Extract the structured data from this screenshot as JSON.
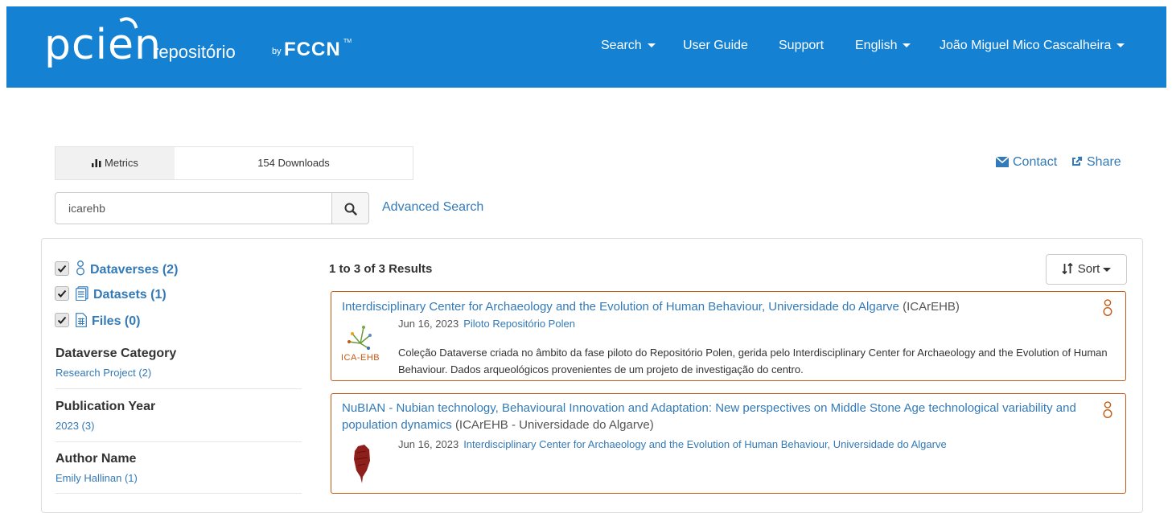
{
  "brand": {
    "logo_text": "pcien",
    "subtitle": "repositório",
    "by": "by",
    "fccn": "FCCN",
    "tm": "TM"
  },
  "nav": {
    "search": "Search",
    "user_guide": "User Guide",
    "support": "Support",
    "language": "English",
    "user": "João Miguel Mico Cascalheira"
  },
  "metrics": {
    "label": "Metrics",
    "downloads": "154 Downloads"
  },
  "actions": {
    "contact": "Contact",
    "share": "Share"
  },
  "search": {
    "value": "icarehb",
    "advanced": "Advanced Search"
  },
  "facets": {
    "types": [
      {
        "label": "Dataverses (2)",
        "checked": true,
        "icon": "dataverse-icon"
      },
      {
        "label": "Datasets (1)",
        "checked": true,
        "icon": "dataset-icon"
      },
      {
        "label": "Files (0)",
        "checked": true,
        "icon": "file-icon"
      }
    ],
    "groups": [
      {
        "title": "Dataverse Category",
        "items": [
          "Research Project (2)"
        ]
      },
      {
        "title": "Publication Year",
        "items": [
          "2023 (3)"
        ]
      },
      {
        "title": "Author Name",
        "items": [
          "Emily Hallinan (1)"
        ]
      }
    ]
  },
  "results": {
    "count": "1 to 3 of 3 Results",
    "sort_label": "Sort",
    "items": [
      {
        "title": "Interdisciplinary Center for Archaeology and the Evolution of Human Behaviour, Universidade do Algarve",
        "affiliation": "(ICArEHB)",
        "date": "Jun 16, 2023",
        "parent": "Piloto Repositório Polen",
        "thumb_text": "ICA-EHB",
        "description": "Coleção Dataverse criada no âmbito da fase piloto do Repositório Polen, gerida pelo Interdisciplinary Center for Archaeology and the Evolution of Human Behaviour. Dados arqueológicos provenientes de um projeto de investigação do centro."
      },
      {
        "title": "NuBIAN - Nubian technology, Behavioural Innovation and Adaptation: New perspectives on Middle Stone Age technological variability and population dynamics",
        "affiliation": "(ICArEHB - Universidade do Algarve)",
        "date": "Jun 16, 2023",
        "parent": "Interdisciplinary Center for Archaeology and the Evolution of Human Behaviour, Universidade do Algarve",
        "description": ""
      }
    ]
  },
  "colors": {
    "navbar": "#1481d3",
    "link": "#337ab7",
    "card_border": "#c55a11",
    "dataverse_icon": "#c55a11"
  }
}
